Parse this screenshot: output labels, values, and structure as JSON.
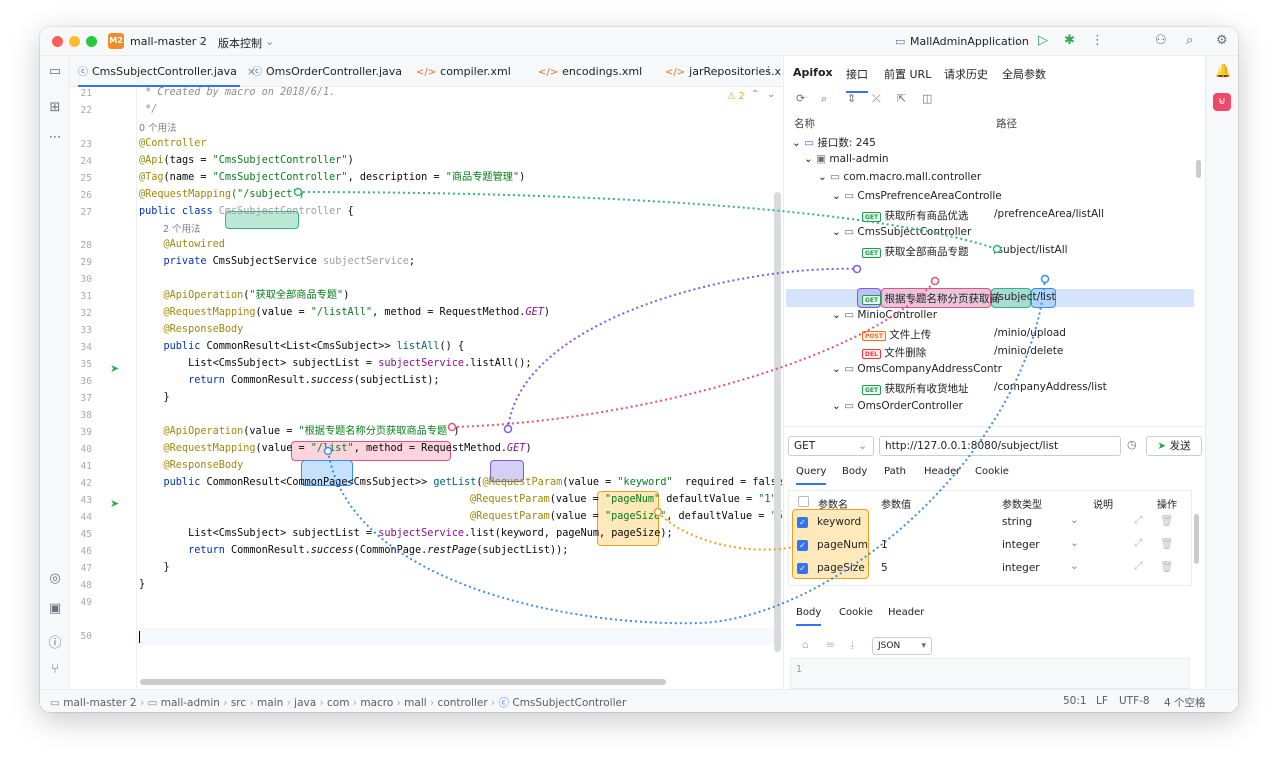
{
  "titlebar": {
    "project_badge": "M2",
    "project_name": "mall-master 2",
    "vcs": "版本控制",
    "run_config": "MallAdminApplication"
  },
  "tabs": [
    {
      "label": "CmsSubjectController.java",
      "active": true
    },
    {
      "label": "OmsOrderController.java"
    },
    {
      "label": "compiler.xml"
    },
    {
      "label": "encodings.xml"
    },
    {
      "label": "jarRepositories.x"
    }
  ],
  "editor": {
    "warnings": "2",
    "usage_0": "0 个用法",
    "usage_2": "2 个用法",
    "line_numbers": [
      "21",
      "22",
      "23",
      "24",
      "25",
      "26",
      "27",
      "28",
      "29",
      "30",
      "31",
      "32",
      "33",
      "34",
      "35",
      "36",
      "37",
      "38",
      "39",
      "40",
      "41",
      "42",
      "43",
      "44",
      "45",
      "46",
      "47",
      "48",
      "49",
      "50"
    ],
    "lines": {
      "l21": " * Created by macro on 2018/6/1.",
      "l22": " */",
      "l23": "@Controller",
      "l24_a": "@Api",
      "l24_b": "(tags = ",
      "l24_c": "\"CmsSubjectController\"",
      "l24_d": ")",
      "l25_a": "@Tag",
      "l25_b": "(name = ",
      "l25_c": "\"CmsSubjectController\"",
      "l25_d": ", description = ",
      "l25_e": "\"商品专题管理\"",
      "l25_f": ")",
      "l26_a": "@RequestMapping",
      "l26_b": "(\"/subject\")",
      "l27_a": "public class ",
      "l27_b": "CmsSubjectController",
      "l27_c": " {",
      "l28": "    @Autowired",
      "l29_a": "    private ",
      "l29_b": "CmsSubjectService ",
      "l29_c": "subjectService",
      "l29_d": ";",
      "l31_a": "    @ApiOperation",
      "l31_b": "(",
      "l31_c": "\"获取全部商品专题\"",
      "l31_d": ")",
      "l32_a": "    @RequestMapping",
      "l32_b": "(value = ",
      "l32_c": "\"/listAll\"",
      "l32_d": ", method = RequestMethod.",
      "l32_e": "GET",
      "l32_f": ")",
      "l33": "    @ResponseBody",
      "l34_a": "    public ",
      "l34_b": "CommonResult<List<CmsSubject>> ",
      "l34_c": "listAll",
      "l34_d": "() {",
      "l35_a": "        List<CmsSubject> subjectList = ",
      "l35_b": "subjectService",
      "l35_c": ".listAll();",
      "l36_a": "        return ",
      "l36_b": "CommonResult.",
      "l36_c": "success",
      "l36_d": "(subjectList);",
      "l37": "    }",
      "l39_a": "    @ApiOperation",
      "l39_b": "(value = ",
      "l39_c": "\"根据专题名称分页获取商品专题\"",
      "l39_d": ")",
      "l40_a": "    @RequestMapping",
      "l40_b": "(value = ",
      "l40_c": "\"/list\"",
      "l40_d": ", method = RequestMethod.",
      "l40_e": "GET",
      "l40_f": ")",
      "l41": "    @ResponseBody",
      "l42_a": "    public ",
      "l42_b": "CommonResult<CommonPage<CmsSubject>> ",
      "l42_c": "getList",
      "l42_d": "(",
      "l42_e": "@RequestParam",
      "l42_f": "(value = ",
      "l42_g": "\"keyword\"",
      "l42_h": "  required = false) St",
      "l43_a": "@RequestParam",
      "l43_b": "(value = ",
      "l43_c": "\"pageNum\"",
      "l43_d": " defaultValue = ",
      "l43_e": "\"1\")",
      "l44_a": "@RequestParam",
      "l44_b": "(value = ",
      "l44_c": "\"pageSize\"",
      "l44_d": ", defaultValue = ",
      "l44_e": "\"5\"",
      "l45_a": "        List<CmsSubject> subjectList = ",
      "l45_b": "subjectService",
      "l45_c": ".list(keyword, pageNum, pageSize);",
      "l46_a": "        return ",
      "l46_b": "CommonResult.",
      "l46_c": "success",
      "l46_d": "(CommonPage.",
      "l46_e": "restPage",
      "l46_f": "(subjectList));",
      "l47": "    }",
      "l48": "}"
    }
  },
  "apifox": {
    "tabs": [
      "Apifox",
      "接口",
      "前置 URL",
      "请求历史",
      "全局参数"
    ],
    "col_name": "名称",
    "col_path": "路径",
    "tree": [
      {
        "label": "接口数: 245"
      },
      {
        "label": "mall-admin"
      },
      {
        "label": "com.macro.mall.controller"
      },
      {
        "label": "CmsPrefrenceAreaControlle"
      },
      {
        "method": "GET",
        "label": "获取所有商品优选",
        "path": "/prefrenceArea/listAll"
      },
      {
        "label": "CmsSubjectController"
      },
      {
        "method": "GET",
        "label": "获取全部商品专题",
        "path": "/subject/listAll"
      },
      {
        "method": "GET",
        "label": "根据专题名称分页获取商",
        "path": "/subject/list"
      },
      {
        "label": "MinioController"
      },
      {
        "method": "POST",
        "label": "文件上传",
        "path": "/minio/upload"
      },
      {
        "method": "DEL",
        "label": "文件删除",
        "path": "/minio/delete"
      },
      {
        "label": "OmsCompanyAddressContr"
      },
      {
        "method": "GET",
        "label": "获取所有收货地址",
        "path": "/companyAddress/list"
      },
      {
        "label": "OmsOrderController"
      }
    ],
    "request": {
      "method": "GET",
      "url": "http://127.0.0.1:8080/subject/list",
      "send": "发送"
    },
    "req_tabs": [
      "Query",
      "Body",
      "Path",
      "Header",
      "Cookie"
    ],
    "param_headers": [
      "参数名",
      "参数值",
      "参数类型",
      "说明",
      "操作"
    ],
    "params": [
      {
        "name": "keyword",
        "value": "",
        "type": "string"
      },
      {
        "name": "pageNum",
        "value": "1",
        "type": "integer"
      },
      {
        "name": "pageSize",
        "value": "5",
        "type": "integer"
      }
    ],
    "resp_tabs": [
      "Body",
      "Cookie",
      "Header"
    ],
    "resp_format": "JSON",
    "resp_line": "1"
  },
  "statusbar": {
    "breadcrumb": [
      "mall-master 2",
      "mall-admin",
      "src",
      "main",
      "java",
      "com",
      "macro",
      "mall",
      "controller",
      "CmsSubjectController"
    ],
    "position": "50:1",
    "line_sep": "LF",
    "encoding": "UTF-8",
    "indent": "4 个空格"
  },
  "colors": {
    "accent": "#3574f0",
    "highlight_green": "#2fb57d",
    "highlight_purple": "#7a5cf0",
    "highlight_red": "#e8507a",
    "highlight_blue": "#3b8ee6",
    "highlight_orange": "#f0a020"
  },
  "icons": [
    "folder-icon",
    "structure-icon",
    "more-icon",
    "run-icon",
    "debug-icon",
    "add-user-icon",
    "search-icon",
    "settings-icon",
    "bell-icon",
    "apifox-icon",
    "terminal-icon",
    "problems-icon",
    "git-icon",
    "refresh-icon",
    "expand-icon",
    "collapse-icon",
    "locate-icon",
    "layout-icon",
    "history-icon",
    "send-icon"
  ]
}
